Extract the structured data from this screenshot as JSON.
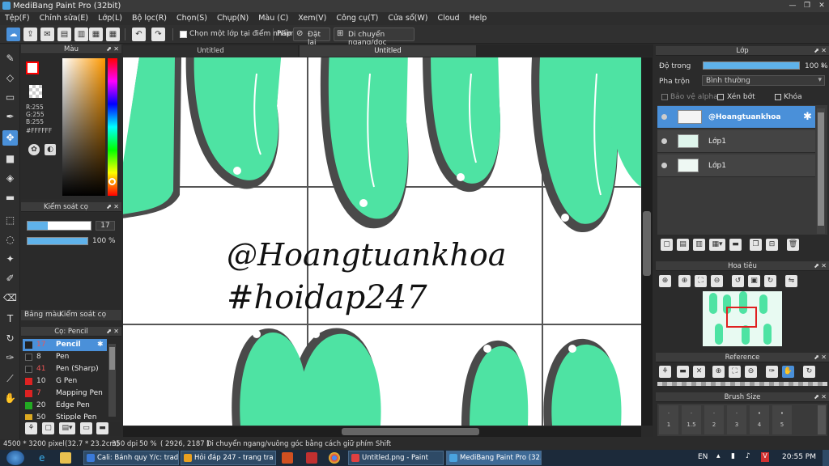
{
  "window": {
    "title": "MediBang Paint Pro (32bit)",
    "minimize": "—",
    "maximize": "❐",
    "close": "✕"
  },
  "menu": [
    "Tệp(F)",
    "Chỉnh sửa(E)",
    "Lớp(L)",
    "Bộ lọc(R)",
    "Chọn(S)",
    "Chụp(N)",
    "Màu (C)",
    "Xem(V)",
    "Công cụ(T)",
    "Cửa sổ(W)",
    "Cloud",
    "Help"
  ],
  "toolbar": {
    "select_layer_label": "Chọn một lớp tại điểm nhấp",
    "shortcut_label": "Phím",
    "reset_label": "Đặt lại",
    "move_hv_label": "Di chuyển ngang/dọc"
  },
  "color_panel": {
    "title": "Màu",
    "rgb_r": "R:255",
    "rgb_g": "G:255",
    "rgb_b": "B:255",
    "hex": "#FFFFFF",
    "primary": "#FF0000"
  },
  "brush_control": {
    "title": "Kiểm soát cọ",
    "size_value": "17",
    "opacity_value": "100 %",
    "tab_color": "Bảng màu",
    "tab_brush": "Kiểm soát cọ"
  },
  "brush_panel": {
    "title": "Cọ: Pencil",
    "items": [
      {
        "size": "17",
        "name": "Pencil",
        "color": "#222222",
        "selected": true
      },
      {
        "size": "8",
        "name": "Pen",
        "color": "#222222",
        "selected": false
      },
      {
        "size": "41",
        "name": "Pen (Sharp)",
        "color": "#222222",
        "selected": false
      },
      {
        "size": "10",
        "name": "G Pen",
        "color": "#dd2222",
        "selected": false
      },
      {
        "size": "7",
        "name": "Mapping Pen",
        "color": "#dd2222",
        "selected": false
      },
      {
        "size": "20",
        "name": "Edge Pen",
        "color": "#22aa22",
        "selected": false
      },
      {
        "size": "50",
        "name": "Stipple Pen",
        "color": "#ddaa22",
        "selected": false
      }
    ]
  },
  "tabs": [
    "Untitled",
    "Untitled"
  ],
  "artwork": {
    "line1": "@Hoangtuankhoa",
    "line2": "#hoidap247",
    "accent": "#4ee3a3",
    "shadow": "#4a4a4a"
  },
  "layer_panel": {
    "title": "Lớp",
    "opacity_label": "Độ trong",
    "opacity_value": "100 %",
    "blend_label": "Pha trộn",
    "blend_value": "Bình thường",
    "protect_alpha": "Bảo vệ alpha",
    "clip": "Xén bớt",
    "lock": "Khóa",
    "layers": [
      {
        "name": "@Hoangtuankhoa",
        "selected": true
      },
      {
        "name": "Lớp1",
        "selected": false
      },
      {
        "name": "Lớp1",
        "selected": false
      }
    ]
  },
  "navigator": {
    "title": "Hoa tiêu"
  },
  "reference": {
    "title": "Reference"
  },
  "brush_size": {
    "title": "Brush Size",
    "sizes": [
      "1",
      "1.5",
      "2",
      "3",
      "4",
      "5"
    ]
  },
  "status": {
    "size": "4500 * 3200 pixel",
    "physical": "(32.7 * 23.2cm)",
    "dpi": "350 dpi",
    "zoom": "50 %",
    "coords": "( 2926, 2187 )",
    "hint": "Di chuyển ngang/vuông góc bằng cách giữ phím Shift"
  },
  "taskbar": {
    "items": [
      {
        "label": "Cali: Bánh quy Y/c: trad...",
        "color": "#3a7ad9"
      },
      {
        "label": "Hỏi đáp 247 - trang tra ...",
        "color": "#e8a020"
      },
      {
        "label": "Untitled.png - Paint",
        "color": "#e04040"
      },
      {
        "label": "MediBang Paint Pro (32...",
        "color": "#4aa3df"
      }
    ],
    "lang": "EN",
    "time": "20:55 PM"
  }
}
